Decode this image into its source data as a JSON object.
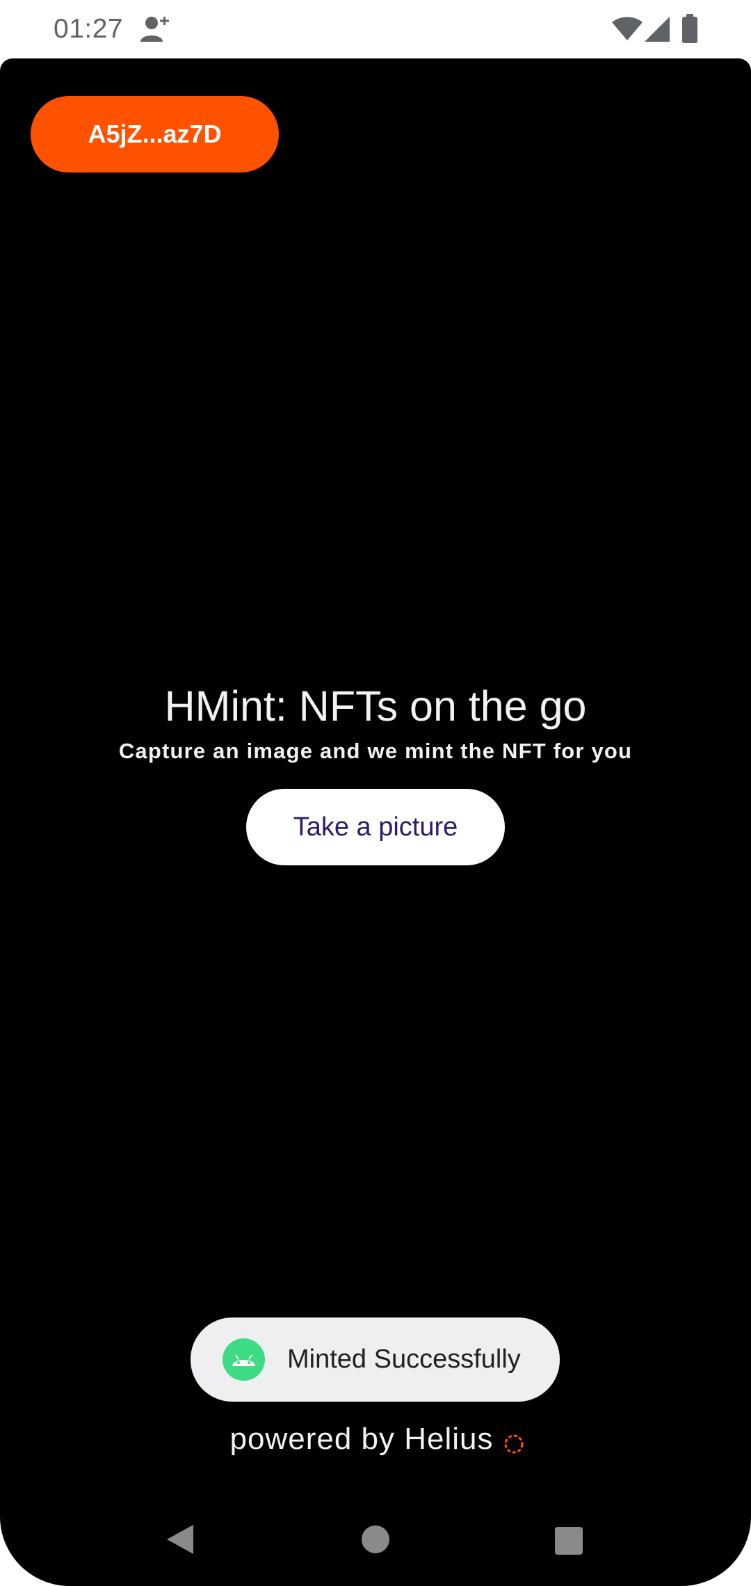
{
  "status_bar": {
    "time": "01:27",
    "icons": [
      "account-plus-icon",
      "wifi-icon",
      "signal-icon",
      "battery-icon"
    ]
  },
  "header": {
    "wallet_label": "A5jZ...az7D",
    "wallet_color": "#ff5200"
  },
  "main": {
    "title": "HMint: NFTs on the go",
    "subtitle": "Capture an image and we mint the NFT for you",
    "take_picture_label": "Take a picture"
  },
  "toast": {
    "message": "Minted Successfully",
    "icon": "android-app-icon"
  },
  "footer": {
    "powered_by": "powered by Helius",
    "icon": "helius-logo-icon"
  },
  "nav_bar": {
    "buttons": [
      "back-icon",
      "home-icon",
      "recents-icon"
    ]
  },
  "colors": {
    "background": "#000000",
    "accent": "#ff5200",
    "button_text": "#2d1b69",
    "toast_bg": "#efeff1"
  }
}
